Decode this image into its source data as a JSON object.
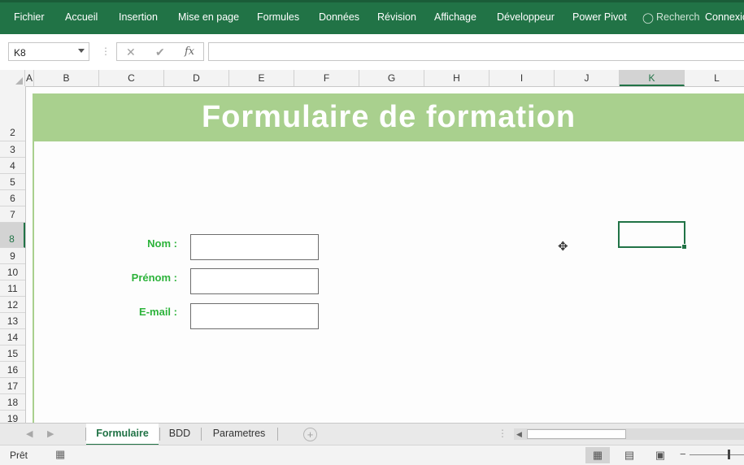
{
  "ribbon": {
    "menu": [
      "Fichier",
      "Accueil",
      "Insertion",
      "Mise en page",
      "Formules",
      "Données",
      "Révision",
      "Affichage",
      "Développeur",
      "Power Pivot"
    ],
    "search_label": "Recherch",
    "connect_label": "Connexio"
  },
  "formula_bar": {
    "name_box": "K8",
    "cancel_icon": "✕",
    "enter_icon": "✔",
    "fx_label": "fx",
    "formula": ""
  },
  "columns": [
    "A",
    "B",
    "C",
    "D",
    "E",
    "F",
    "G",
    "H",
    "I",
    "J",
    "K",
    "L"
  ],
  "rows": [
    "2",
    "3",
    "4",
    "5",
    "6",
    "7",
    "8",
    "9",
    "10",
    "11",
    "12",
    "13",
    "14",
    "15",
    "16",
    "17",
    "18",
    "19"
  ],
  "selected": {
    "column": "K",
    "row": "8"
  },
  "sheet": {
    "title": "Formulaire de formation",
    "fields": [
      {
        "label": "Nom :",
        "value": ""
      },
      {
        "label": "Prénom :",
        "value": ""
      },
      {
        "label": "E-mail :",
        "value": ""
      }
    ]
  },
  "tabs": {
    "sheets": [
      "Formulaire",
      "BDD",
      "Parametres"
    ],
    "active": "Formulaire"
  },
  "status": {
    "ready": "Prêt",
    "zoom_minus": "−"
  },
  "colors": {
    "ribbon": "#217346",
    "banner": "#a9d08e",
    "label_green": "#2db33b"
  }
}
